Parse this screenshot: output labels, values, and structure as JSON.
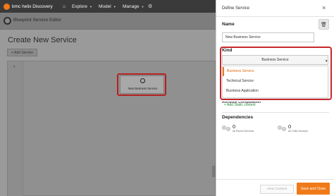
{
  "topnav": {
    "brand": "bmc helix Discovery",
    "items": [
      {
        "icon": "home-icon",
        "label": ""
      },
      {
        "icon": "",
        "label": "Explore"
      },
      {
        "icon": "",
        "label": "Model"
      },
      {
        "icon": "",
        "label": "Manage"
      },
      {
        "icon": "gear-icon",
        "label": ""
      }
    ]
  },
  "page": {
    "subbar_title": "Blueprint Service Editor",
    "title": "Create New Service",
    "add_service": "+ Add Service",
    "node_label": "New Business Service"
  },
  "drawer": {
    "title": "Define Service",
    "name_label": "Name",
    "name_value": "New Business Service",
    "kind_label": "Kind",
    "kind_selected": "Business Service",
    "kind_options": [
      "Business Service",
      "Technical Service",
      "Business Application"
    ],
    "attribute_label": "Attribute Computation",
    "add_static_content": "+ Add Static content",
    "dependencies_label": "Dependencies",
    "parent_count": "0",
    "parent_label": "All Parent Services",
    "child_count": "0",
    "child_label": "All Child Services",
    "view_content": "View Content",
    "save_close": "Save and Close"
  },
  "colors": {
    "accent": "#f07a1a",
    "highlight": "#c8272c",
    "link": "#2a8a3a",
    "nav": "#3a3a3a"
  }
}
